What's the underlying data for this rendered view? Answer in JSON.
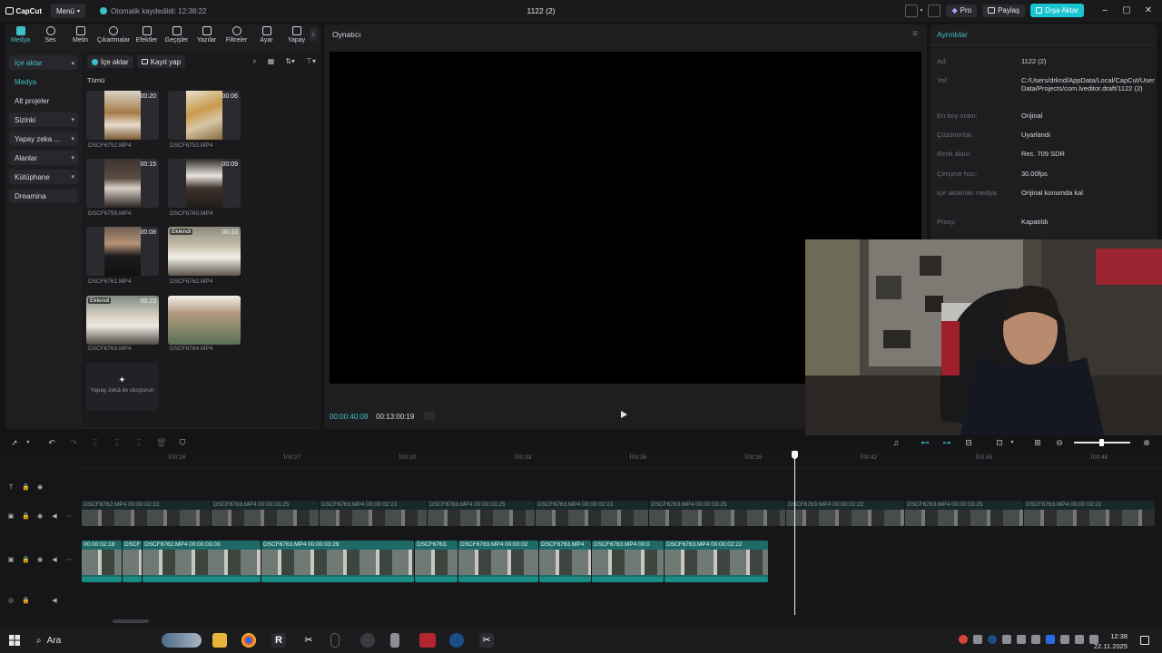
{
  "app": {
    "logo_text": "CapCut",
    "menu_label": "Menü",
    "autosave_text": "Otomatik kaydedildi: 12:38:22",
    "title": "1122 (2)",
    "pro_label": "Pro",
    "share_label": "Paylaş",
    "export_label": "Dışa Aktar",
    "accent_color": "#19c3cf"
  },
  "tool_tabs": [
    {
      "label": "Medya",
      "icon": "media-icon"
    },
    {
      "label": "Ses",
      "icon": "audio-icon"
    },
    {
      "label": "Metin",
      "icon": "text-icon"
    },
    {
      "label": "Çıkartmalar",
      "icon": "sticker-icon"
    },
    {
      "label": "Efektler",
      "icon": "effects-icon"
    },
    {
      "label": "Geçişler",
      "icon": "transitions-icon"
    },
    {
      "label": "Yazılar",
      "icon": "captions-icon"
    },
    {
      "label": "Filtreler",
      "icon": "filters-icon"
    },
    {
      "label": "Ayar",
      "icon": "adjust-icon"
    },
    {
      "label": "Yapay",
      "icon": "ai-icon"
    }
  ],
  "side_nav": [
    {
      "label": "İçe aktar",
      "chevron": "▴"
    },
    {
      "label": "Medya",
      "chevron": ""
    },
    {
      "label": "Alt projeler",
      "chevron": ""
    },
    {
      "label": "Sizinki",
      "chevron": "▾"
    },
    {
      "label": "Yapay zeka ...",
      "chevron": "▾"
    },
    {
      "label": "Alanlar",
      "chevron": "▾"
    },
    {
      "label": "Kütüphane",
      "chevron": "▾"
    },
    {
      "label": "Dreamina",
      "chevron": ""
    }
  ],
  "media": {
    "import_label": "İçe aktar",
    "record_label": "Kayıt yap",
    "filter_label": "Tümü",
    "items": [
      {
        "name": "DSCF6752.MP4",
        "duration": "00:20",
        "added": ""
      },
      {
        "name": "DSCF6753.MP4",
        "duration": "00:06",
        "added": ""
      },
      {
        "name": "DSCF6759.MP4",
        "duration": "00:15",
        "added": ""
      },
      {
        "name": "DSCF6760.MP4",
        "duration": "00:09",
        "added": ""
      },
      {
        "name": "DSCF6761.MP4",
        "duration": "00:08",
        "added": ""
      },
      {
        "name": "DSCF6762.MP4",
        "duration": "00:33",
        "added": "Eklendi"
      },
      {
        "name": "DSCF6763.MP4",
        "duration": "00:23",
        "added": "Eklendi"
      },
      {
        "name": "DSCF6764.MP4",
        "duration": "",
        "added": ""
      }
    ],
    "generate_label": "Yapay zekâ ile oluşturun"
  },
  "player": {
    "title": "Oynatıcı",
    "current_time": "00:00:40:08",
    "total_time": "00:13:00:19"
  },
  "details": {
    "title": "Ayrıntılar",
    "rows": [
      {
        "key": "Ad:",
        "value": "1122 (2)"
      },
      {
        "key": "Yol:",
        "value": "C:/Users/drknd/AppData/Local/CapCut/User Data/Projects/com.lveditor.draft/1122 (2)"
      },
      {
        "key": "En boy oranı:",
        "value": "Orijinal"
      },
      {
        "key": "Çözünürlük:",
        "value": "Uyarlandı"
      },
      {
        "key": "Renk alanı:",
        "value": "Rec. 709 SDR"
      },
      {
        "key": "Çerçeve hızı:",
        "value": "30.00fps"
      },
      {
        "key": "İçe aktarılan medya:",
        "value": "Orijinal konumda kal"
      },
      {
        "key": "Proxy:",
        "value": "Kapatıldı"
      }
    ]
  },
  "ruler": [
    "00:24",
    "00:27",
    "00:30",
    "00:33",
    "00:36",
    "00:39",
    "00:42",
    "00:45",
    "00:48"
  ],
  "ghost_clips": [
    {
      "label": "DSCF6762.MP4  00:00:02:22"
    },
    {
      "label": "DSCF6763.MP4  00:00:03:25"
    },
    {
      "label": "DSCF6763.MP4  00:00:02:22"
    },
    {
      "label": "DSCF6763.MP4  00:00:03:25"
    },
    {
      "label": "DSCF6763.MP4  00:00:02:22"
    },
    {
      "label": "DSCF6763.MP4  00:00:03:25"
    },
    {
      "label": "DSCF6763.MP4  00:00:02:22"
    },
    {
      "label": "DSCF6763.MP4  00:00:03:25"
    },
    {
      "label": "DSCF6763.MP4  00:00:02:22"
    }
  ],
  "main_clips": [
    {
      "label": "00:00:02:18"
    },
    {
      "label": "DSCF"
    },
    {
      "label": "DSCF6762.MP4  00:00:03:03"
    },
    {
      "label": "DSCF6763.MP4  00:00:03:29"
    },
    {
      "label": "DSCF6763."
    },
    {
      "label": "DSCF6763.MP4  00:00:02"
    },
    {
      "label": "DSCF6763.MP4"
    },
    {
      "label": "DSCF6763.MP4  00:0"
    },
    {
      "label": "DSCF6763.MP4   00:00:02:22"
    }
  ],
  "taskbar": {
    "search_label": "Ara",
    "time": "12:38",
    "date": "22.11.2025"
  }
}
